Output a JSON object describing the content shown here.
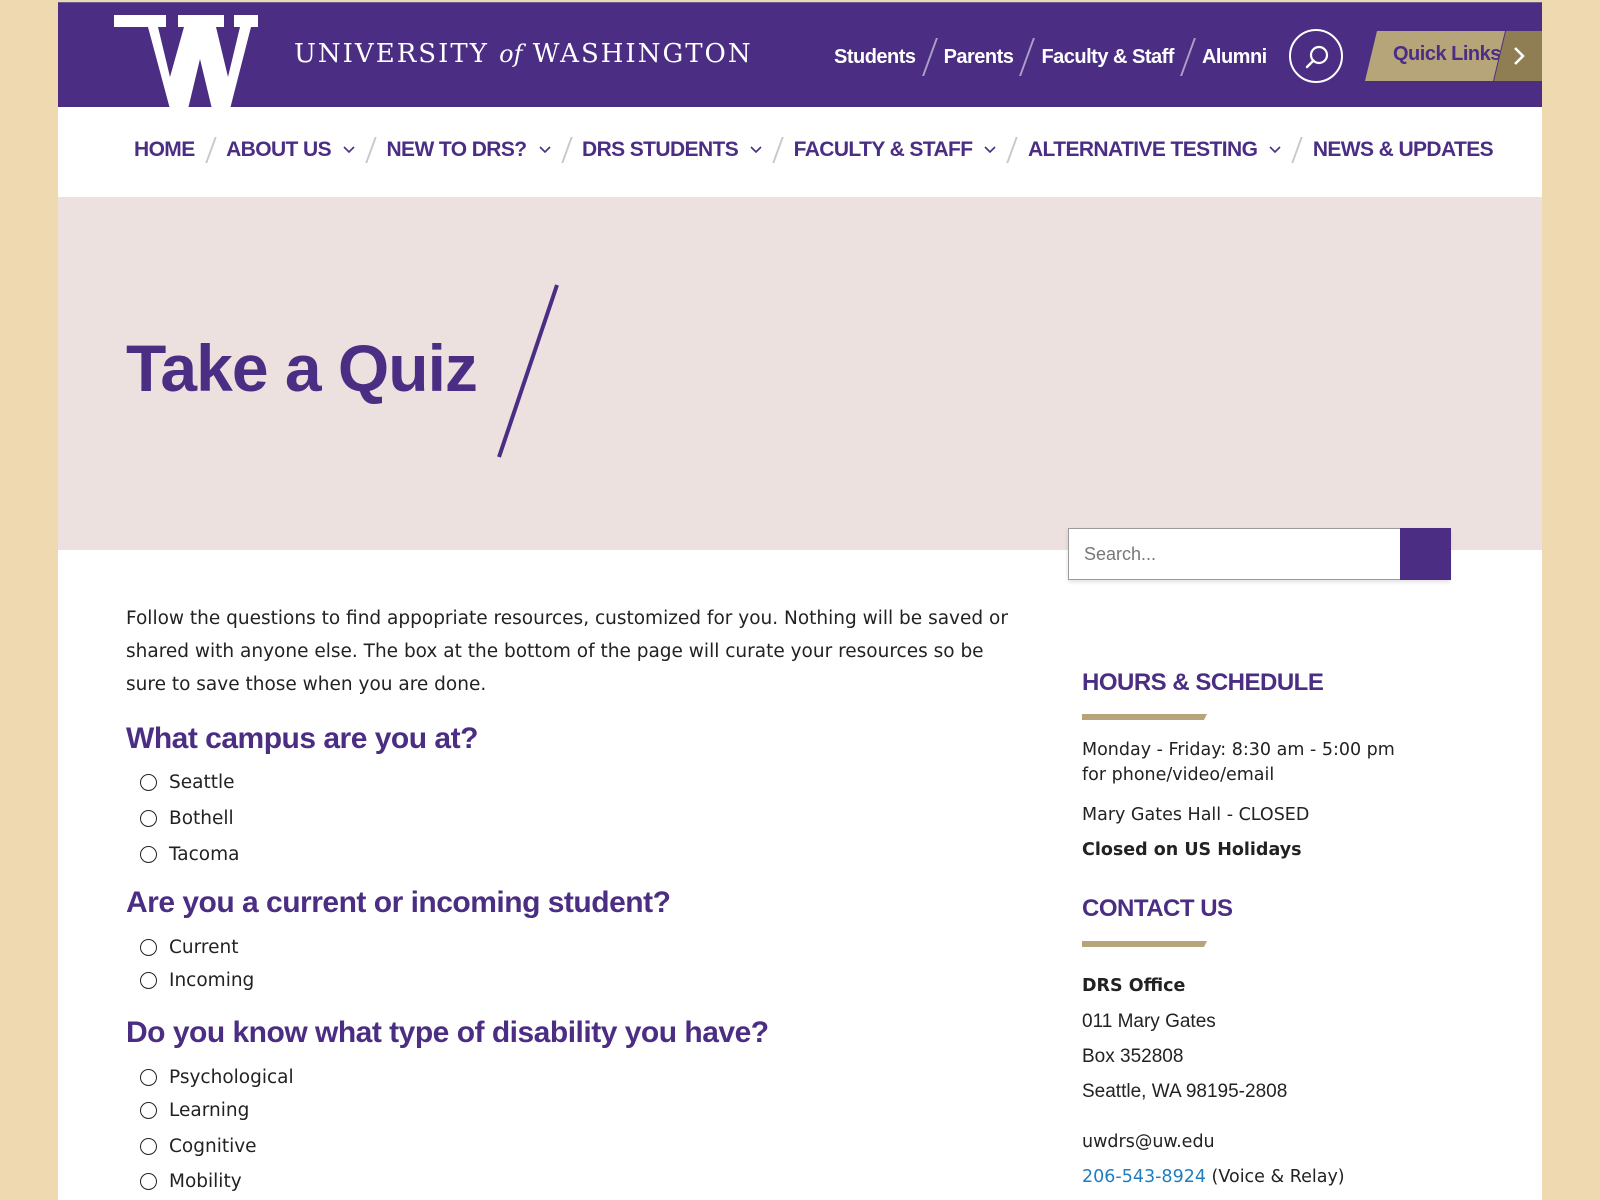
{
  "header": {
    "wordmark": {
      "pre": "UNIVERSITY ",
      "of": "of",
      "post": " WASHINGTON"
    },
    "audience_links": [
      "Students",
      "Parents",
      "Faculty & Staff",
      "Alumni"
    ],
    "quick_links_label": "Quick Links"
  },
  "nav": {
    "items": [
      {
        "label": "HOME"
      },
      {
        "label": "ABOUT US"
      },
      {
        "label": "NEW TO DRS?"
      },
      {
        "label": "DRS STUDENTS"
      },
      {
        "label": "FACULTY & STAFF"
      },
      {
        "label": "ALTERNATIVE TESTING"
      },
      {
        "label": "NEWS & UPDATES"
      }
    ]
  },
  "hero": {
    "title": "Take a Quiz"
  },
  "search": {
    "placeholder": "Search..."
  },
  "content": {
    "intro": "Follow the questions to find appopriate resources, customized for you. Nothing will be saved or shared with anyone else. The box at the bottom of the page will curate your resources so be sure to save those when you are done.",
    "questions": [
      {
        "heading": "What campus are you at?",
        "options": [
          "Seattle",
          "Bothell",
          "Tacoma"
        ]
      },
      {
        "heading": "Are you a current or incoming student?",
        "options": [
          "Current",
          "Incoming"
        ]
      },
      {
        "heading": "Do you know what type of disability you have?",
        "options": [
          "Psychological",
          "Learning",
          "Cognitive",
          "Mobility"
        ]
      }
    ]
  },
  "sidebar": {
    "hours": {
      "heading": "HOURS & SCHEDULE",
      "line1": "Monday - Friday: 8:30 am - 5:00 pm",
      "line2": "for phone/video/email",
      "line3": "Mary Gates Hall - CLOSED",
      "line4": "Closed on US Holidays"
    },
    "contact": {
      "heading": "CONTACT US",
      "office": "DRS Office",
      "address1": "011 Mary Gates",
      "address2": "Box 352808",
      "address3": "Seattle, WA 98195-2808",
      "email": "uwdrs@uw.edu",
      "phone": "206-543-8924",
      "phone_note": " (Voice & Relay)"
    }
  },
  "colors": {
    "purple": "#4b2e83",
    "gold": "#b7a57a",
    "hero_bg": "#ede1df",
    "outer_bg": "#efd9b0"
  },
  "icons": [
    "uw-w-logo",
    "search-icon",
    "chevron-right-icon",
    "chevron-down-icon",
    "radio-icon"
  ]
}
